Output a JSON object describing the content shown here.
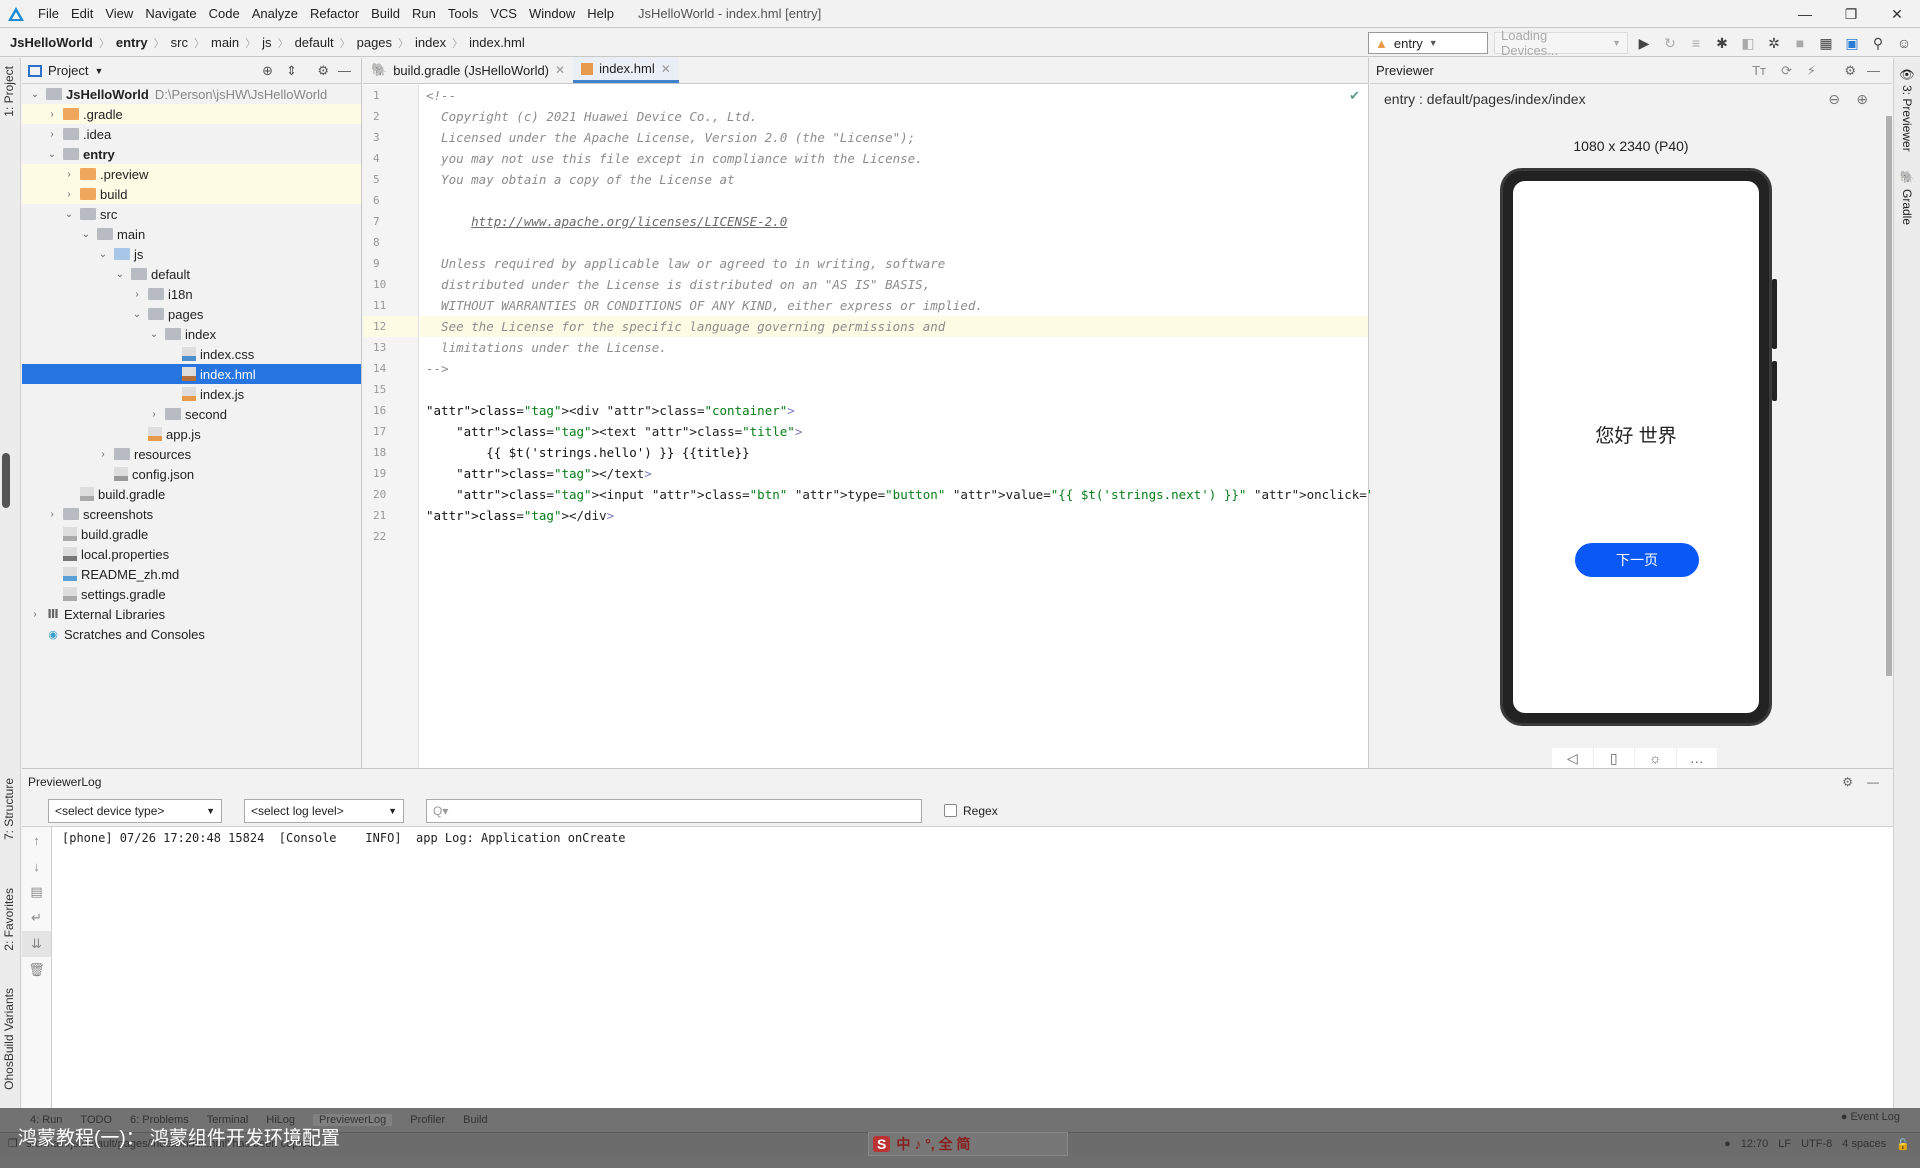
{
  "window": {
    "title": "JsHelloWorld - index.hml [entry]",
    "controls": {
      "minimize": "—",
      "maximize": "❐",
      "close": "✕"
    }
  },
  "menu": [
    "File",
    "Edit",
    "View",
    "Navigate",
    "Code",
    "Analyze",
    "Refactor",
    "Build",
    "Run",
    "Tools",
    "VCS",
    "Window",
    "Help"
  ],
  "breadcrumb": [
    "JsHelloWorld",
    "entry",
    "src",
    "main",
    "js",
    "default",
    "pages",
    "index",
    "index.hml"
  ],
  "toolbar": {
    "module_select": "entry",
    "device_select": "Loading Devices...",
    "icons": [
      "run-icon",
      "rerun-icon",
      "coverage-icon",
      "debug-icon",
      "profile-icon",
      "attach-debugger-icon",
      "stop-icon",
      "project-structure-icon",
      "terminal-icon",
      "search-icon",
      "account-icon"
    ]
  },
  "left_strip": {
    "project_tab": "1: Project",
    "structure_tab": "7: Structure",
    "favorites_tab": "2: Favorites",
    "build_variants_tab": "OhosBuild Variants"
  },
  "project": {
    "header": "Project",
    "tree": [
      {
        "label": "JsHelloWorld",
        "path": "D:\\Person\\jsHW\\JsHelloWorld",
        "depth": 0,
        "chev": "v",
        "icon": "module",
        "bold": true
      },
      {
        "label": ".gradle",
        "depth": 1,
        "chev": ">",
        "icon": "folder-orange",
        "hl": true
      },
      {
        "label": ".idea",
        "depth": 1,
        "chev": ">",
        "icon": "folder"
      },
      {
        "label": "entry",
        "depth": 1,
        "chev": "v",
        "icon": "module",
        "bold": true
      },
      {
        "label": ".preview",
        "depth": 2,
        "chev": ">",
        "icon": "folder-orange",
        "hl": true
      },
      {
        "label": "build",
        "depth": 2,
        "chev": ">",
        "icon": "folder-orange",
        "hl": true
      },
      {
        "label": "src",
        "depth": 2,
        "chev": "v",
        "icon": "folder"
      },
      {
        "label": "main",
        "depth": 3,
        "chev": "v",
        "icon": "folder"
      },
      {
        "label": "js",
        "depth": 4,
        "chev": "v",
        "icon": "folder-blue"
      },
      {
        "label": "default",
        "depth": 5,
        "chev": "v",
        "icon": "folder"
      },
      {
        "label": "i18n",
        "depth": 6,
        "chev": ">",
        "icon": "folder"
      },
      {
        "label": "pages",
        "depth": 6,
        "chev": "v",
        "icon": "folder"
      },
      {
        "label": "index",
        "depth": 7,
        "chev": "v",
        "icon": "folder"
      },
      {
        "label": "index.css",
        "depth": 8,
        "chev": "",
        "icon": "css"
      },
      {
        "label": "index.hml",
        "depth": 8,
        "chev": "",
        "icon": "hml",
        "selected": true
      },
      {
        "label": "index.js",
        "depth": 8,
        "chev": "",
        "icon": "js"
      },
      {
        "label": "second",
        "depth": 7,
        "chev": ">",
        "icon": "folder"
      },
      {
        "label": "app.js",
        "depth": 6,
        "chev": "",
        "icon": "js"
      },
      {
        "label": "resources",
        "depth": 4,
        "chev": ">",
        "icon": "folder-res"
      },
      {
        "label": "config.json",
        "depth": 4,
        "chev": "",
        "icon": "json"
      },
      {
        "label": "build.gradle",
        "depth": 2,
        "chev": "",
        "icon": "gradle"
      },
      {
        "label": "screenshots",
        "depth": 1,
        "chev": ">",
        "icon": "folder"
      },
      {
        "label": "build.gradle",
        "depth": 1,
        "chev": "",
        "icon": "gradle"
      },
      {
        "label": "local.properties",
        "depth": 1,
        "chev": "",
        "icon": "properties"
      },
      {
        "label": "README_zh.md",
        "depth": 1,
        "chev": "",
        "icon": "md"
      },
      {
        "label": "settings.gradle",
        "depth": 1,
        "chev": "",
        "icon": "gradle"
      },
      {
        "label": "External Libraries",
        "depth": 0,
        "chev": ">",
        "icon": "libraries"
      },
      {
        "label": "Scratches and Consoles",
        "depth": 0,
        "chev": "",
        "icon": "scratches"
      }
    ]
  },
  "editor": {
    "tabs": [
      {
        "label": "build.gradle (JsHelloWorld)",
        "active": false
      },
      {
        "label": "index.hml",
        "active": true
      }
    ],
    "highlighted_line": 12,
    "lines": [
      "<!--",
      "  Copyright (c) 2021 Huawei Device Co., Ltd.",
      "  Licensed under the Apache License, Version 2.0 (the \"License\");",
      "  you may not use this file except in compliance with the License.",
      "  You may obtain a copy of the License at",
      "",
      "      http://www.apache.org/licenses/LICENSE-2.0",
      "",
      "  Unless required by applicable law or agreed to in writing, software",
      "  distributed under the License is distributed on an \"AS IS\" BASIS,",
      "  WITHOUT WARRANTIES OR CONDITIONS OF ANY KIND, either express or implied.",
      "  See the License for the specific language governing permissions and",
      "  limitations under the License.",
      "-->",
      "",
      "<div class=\"container\">",
      "    <text class=\"title\">",
      "        {{ $t('strings.hello') }} {{title}}",
      "    </text>",
      "    <input class=\"btn\" type=\"button\" value=\"{{ $t('strings.next') }}\" onclick=\"onclick\"></input>",
      "</div>",
      ""
    ]
  },
  "previewer": {
    "header": "Previewer",
    "page_path": "entry : default/pages/index/index",
    "device_label": "1080 x 2340 (P40)",
    "phone_title": "您好 世界",
    "phone_button": "下一页",
    "accent": "#0a59f7"
  },
  "right_strip": {
    "previewer_tab": "3: Previewer",
    "gradle_tab": "Gradle"
  },
  "log": {
    "header": "PreviewerLog",
    "device_type": "<select device type>",
    "log_level": "<select log level>",
    "search_placeholder": "Q▾",
    "regex_label": "Regex",
    "entries": [
      "[phone] 07/26 17:20:48 15824  [Console    INFO]  app Log: Application onCreate"
    ]
  },
  "bottom_tabs": [
    "4: Run",
    "TODO",
    "6: Problems",
    "Terminal",
    "HiLog",
    "PreviewerLog",
    "Profiler",
    "Build"
  ],
  "status": {
    "message": "'src/main/js/default/pages/index/index.hml' has been copied.",
    "event_log": "Event Log",
    "position": "12:70",
    "line_sep": "LF",
    "encoding": "UTF-8",
    "indent": "4 spaces"
  },
  "overlay": {
    "watermark": "鸿蒙教程(一)： 鸿蒙组件开发环境配置",
    "ime_items": "中 ♪ °, 全 简"
  }
}
